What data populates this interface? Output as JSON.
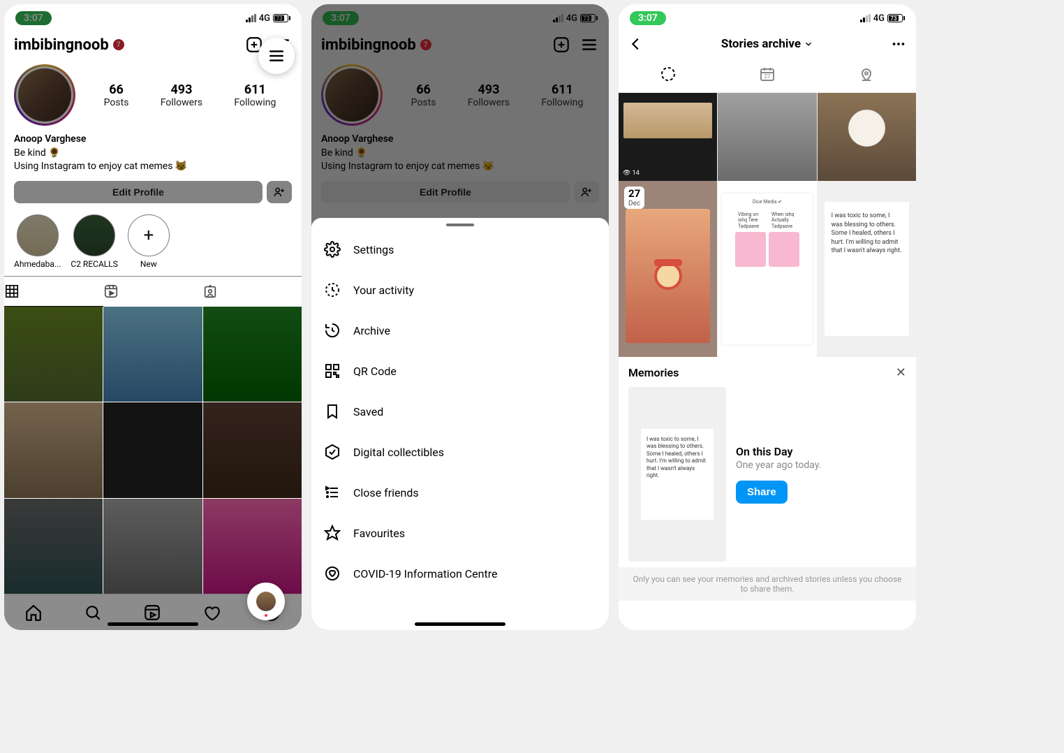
{
  "status": {
    "time": "3:07",
    "network": "4G",
    "battery_pct": "73"
  },
  "profile": {
    "username": "imbibingnoob",
    "name": "Anoop Varghese",
    "bio_line1": "Be kind 🌻",
    "bio_line2": "Using Instagram to enjoy cat memes 😼",
    "edit_label": "Edit Profile",
    "stats": {
      "posts_num": "66",
      "posts_lbl": "Posts",
      "followers_num": "493",
      "followers_lbl": "Followers",
      "following_num": "611",
      "following_lbl": "Following"
    },
    "highlights": [
      {
        "label": "Ahmedaba..."
      },
      {
        "label": "C2 RECALLS"
      },
      {
        "label": "New"
      }
    ]
  },
  "menu": {
    "items": [
      {
        "label": "Settings"
      },
      {
        "label": "Your activity"
      },
      {
        "label": "Archive"
      },
      {
        "label": "QR Code"
      },
      {
        "label": "Saved"
      },
      {
        "label": "Digital collectibles"
      },
      {
        "label": "Close friends"
      },
      {
        "label": "Favourites"
      },
      {
        "label": "COVID-19 Information Centre"
      }
    ]
  },
  "archive": {
    "title": "Stories archive",
    "date_day": "27",
    "date_month": "Dec",
    "story_text_a": "Vibing on ishq Tere Tadpaave",
    "story_text_b": "When ishq Actually Tadpaave",
    "story_quote": "I was toxic to some, I was blessing to others. Some I healed, others I hurt. I'm willing to admit that I wasn't always right.",
    "memories_title": "Memories",
    "on_this_day": "On this Day",
    "one_year": "One year ago today.",
    "share_label": "Share",
    "footer": "Only you can see your memories and archived stories unless you choose to share them."
  }
}
